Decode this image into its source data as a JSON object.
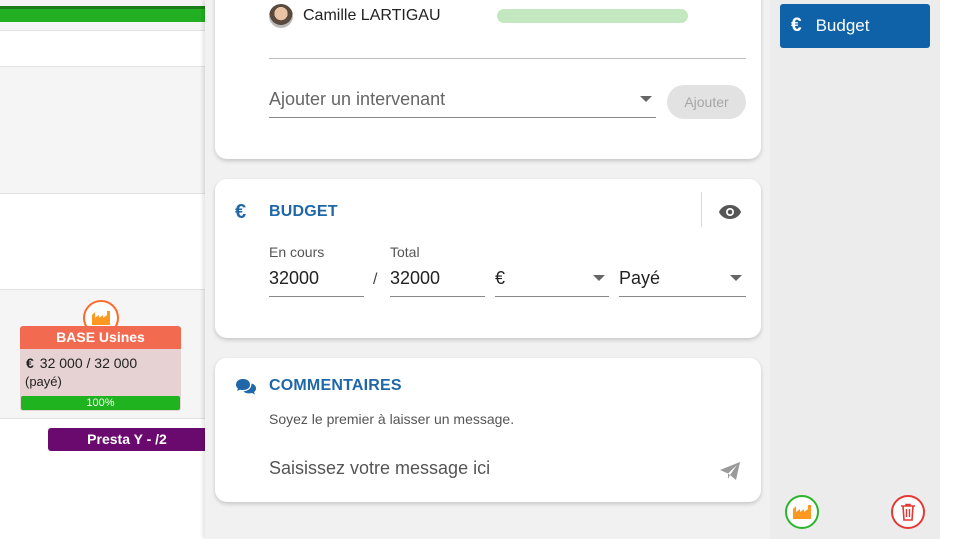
{
  "intervenants": {
    "person_name": "Camille LARTIGAU",
    "select_placeholder": "Ajouter un intervenant",
    "add_button_label": "Ajouter"
  },
  "budget": {
    "title": "BUDGET",
    "icon": "euro-icon",
    "en_cours_label": "En cours",
    "total_label": "Total",
    "en_cours_value": "32000",
    "separator": "/",
    "total_value": "32000",
    "currency": "€",
    "status": "Payé"
  },
  "comments": {
    "title": "COMMENTAIRES",
    "empty_hint": "Soyez le premier à laisser un message.",
    "input_placeholder": "Saisissez votre message ici"
  },
  "sidebar": {
    "budget_button_label": "Budget",
    "budget_button_icon": "€"
  },
  "planning": {
    "base_card": {
      "title": "BASE Usines",
      "currency": "€",
      "amount": "32 000 / 32 000",
      "status": "(payé)",
      "progress_label": "100%",
      "progress": 1.0
    },
    "presta_label": "Presta Y - /2"
  },
  "colors": {
    "accent_blue": "#1f67a8",
    "button_blue": "#0f62a8",
    "base_orange": "#f26a50",
    "progress_green": "#1fb31f",
    "presta_purple": "#6a0a6e",
    "delete_red": "#e53935"
  }
}
